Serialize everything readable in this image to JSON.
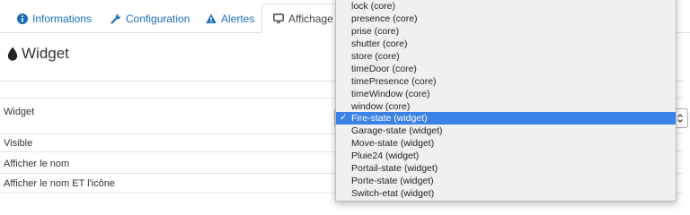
{
  "tabs": [
    {
      "label": "Informations",
      "icon": "info-circle-icon"
    },
    {
      "label": "Configuration",
      "icon": "wrench-icon"
    },
    {
      "label": "Alertes",
      "icon": "warning-icon"
    },
    {
      "label": "Affichage",
      "icon": "monitor-icon"
    }
  ],
  "section": {
    "title": "Widget",
    "icon": "tint-drop-icon"
  },
  "rows": [
    {
      "label": "Widget"
    },
    {
      "label": "Visible"
    },
    {
      "label": "Afficher le nom"
    },
    {
      "label": "Afficher le nom ET l'icône"
    }
  ],
  "dropdown": {
    "options": [
      "lock (core)",
      "presence (core)",
      "prise (core)",
      "shutter (core)",
      "store (core)",
      "timeDoor (core)",
      "timePresence (core)",
      "timeWindow (core)",
      "window (core)",
      "Fire-state (widget)",
      "Garage-state (widget)",
      "Move-state (widget)",
      "Pluie24 (widget)",
      "Portail-state (widget)",
      "Porte-state (widget)",
      "Switch-etat (widget)"
    ],
    "selected": "Fire-state (widget)",
    "check_mark": "✓"
  },
  "colors": {
    "link": "#1e6fb8",
    "selection": "#3b82e6"
  }
}
